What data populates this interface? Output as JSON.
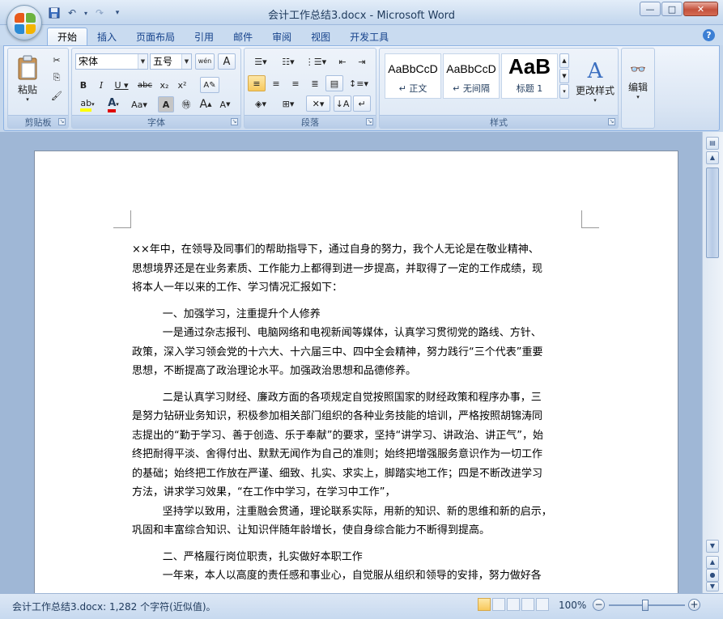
{
  "window": {
    "title": "会计工作总结3.docx - Microsoft Word",
    "controls": {
      "minimize": "—",
      "maximize": "□",
      "close": "✕"
    }
  },
  "qat": {
    "save": "💾",
    "undo": "↶",
    "redo": "↷",
    "more": "▾"
  },
  "tabs": [
    "开始",
    "插入",
    "页面布局",
    "引用",
    "邮件",
    "审阅",
    "视图",
    "开发工具"
  ],
  "active_tab": "开始",
  "ribbon": {
    "clipboard": {
      "label": "剪贴板",
      "paste": "粘贴"
    },
    "font": {
      "label": "字体",
      "font_name": "宋体",
      "font_size": "五号",
      "wen": "wén\n变",
      "a_box": "A"
    },
    "paragraph": {
      "label": "段落"
    },
    "styles": {
      "label": "样式",
      "items": [
        {
          "sample": "AaBbCcD",
          "name": "↵ 正文"
        },
        {
          "sample": "AaBbCcD",
          "name": "↵ 无间隔"
        },
        {
          "sample": "AaB",
          "name": "标题 1"
        }
      ],
      "change_styles": "更改样式"
    },
    "editing": {
      "label": "编辑"
    }
  },
  "document": {
    "paragraphs": [
      {
        "text": "××年中，在领导及同事们的帮助指导下，通过自身的努力，我个人无论是在敬业精神、",
        "indent": false,
        "kind": "line"
      },
      {
        "text": "思想境界还是在业务素质、工作能力上都得到进一步提高，并取得了一定的工作成绩，现",
        "indent": false,
        "kind": "line"
      },
      {
        "text": "将本人一年以来的工作、学习情况汇报如下：",
        "indent": false,
        "kind": "line"
      },
      {
        "text": "一、加强学习，注重提升个人修养",
        "indent": true,
        "kind": "heading"
      },
      {
        "text": "一是通过杂志报刊、电脑网络和电视新闻等媒体，认真学习贯彻党的路线、方针、",
        "indent": true,
        "kind": "line"
      },
      {
        "text": "政策，深入学习领会党的十六大、十六届三中、四中全会精神，努力践行“三个代表”重要",
        "indent": false,
        "kind": "line"
      },
      {
        "text": "思想，不断提高了政治理论水平。加强政治思想和品德修养。",
        "indent": false,
        "kind": "line"
      },
      {
        "text": "二是认真学习财经、廉政方面的各项规定自觉按照国家的财经政策和程序办事，三",
        "indent": true,
        "kind": "gap"
      },
      {
        "text": "是努力钻研业务知识，积极参加相关部门组织的各种业务技能的培训，严格按照胡锦涛同",
        "indent": false,
        "kind": "line"
      },
      {
        "text": "志提出的“勤于学习、善于创造、乐于奉献”的要求，坚持“讲学习、讲政治、讲正气”，始",
        "indent": false,
        "kind": "line"
      },
      {
        "text": "终把耐得平淡、舍得付出、默默无闻作为自己的准则；始终把增强服务意识作为一切工作",
        "indent": false,
        "kind": "line"
      },
      {
        "text": "的基础；始终把工作放在严谨、细致、扎实、求实上，脚踏实地工作；四是不断改进学习",
        "indent": false,
        "kind": "line"
      },
      {
        "text": "方法，讲求学习效果，“在工作中学习，在学习中工作”，",
        "indent": false,
        "kind": "line"
      },
      {
        "text": "坚持学以致用，注重融会贯通，理论联系实际，用新的知识、新的思维和新的启示，",
        "indent": true,
        "kind": "line"
      },
      {
        "text": "巩固和丰富综合知识、让知识伴随年龄增长，使自身综合能力不断得到提高。",
        "indent": false,
        "kind": "line"
      },
      {
        "text": "二、严格履行岗位职责，扎实做好本职工作",
        "indent": true,
        "kind": "heading"
      },
      {
        "text": "一年来，本人以高度的责任感和事业心，自觉服从组织和领导的安排，努力做好各",
        "indent": true,
        "kind": "line"
      }
    ]
  },
  "statusbar": {
    "text": "会计工作总结3.docx: 1,282 个字符(近似值)。",
    "zoom": "100%",
    "zoom_minus": "−",
    "zoom_plus": "+"
  }
}
